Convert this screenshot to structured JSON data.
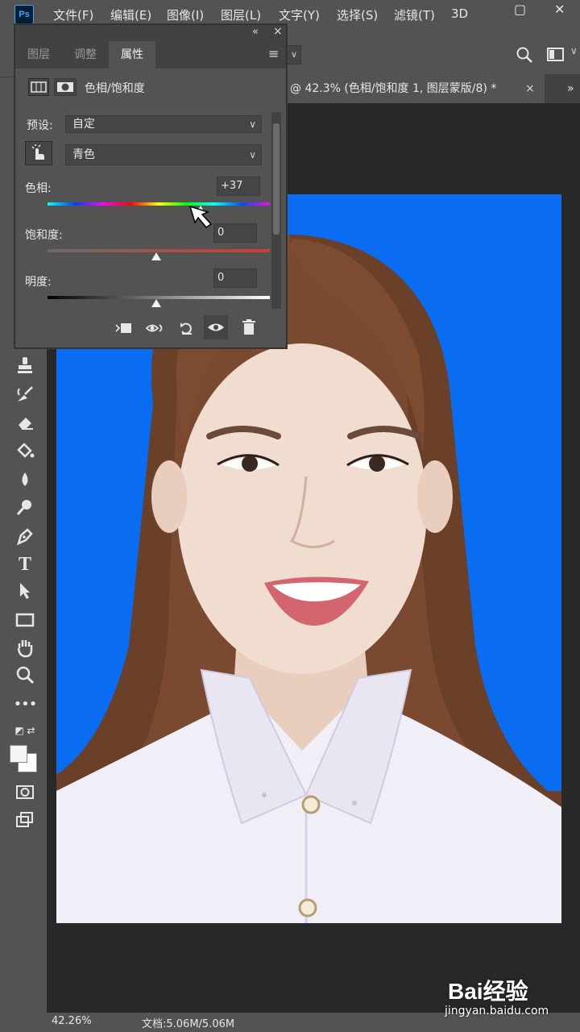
{
  "app": {
    "logo": "Ps"
  },
  "menu": [
    {
      "label": "文件(F)"
    },
    {
      "label": "编辑(E)"
    },
    {
      "label": "图像(I)"
    },
    {
      "label": "图层(L)"
    },
    {
      "label": "文字(Y)"
    },
    {
      "label": "选择(S)"
    },
    {
      "label": "滤镜(T)"
    },
    {
      "label": "3D"
    }
  ],
  "document_tab": {
    "title": "@ 42.3% (色相/饱和度 1, 图层蒙版/8) *",
    "close": "×",
    "more": "»"
  },
  "properties_panel": {
    "collapse": "«",
    "close": "×",
    "tabs": [
      {
        "label": "图层"
      },
      {
        "label": "调整"
      },
      {
        "label": "属性",
        "active": true
      }
    ],
    "menu_icon": "≡",
    "adjustment_title": "色相/饱和度",
    "preset": {
      "label": "预设:",
      "value": "自定"
    },
    "channel": {
      "value": "青色"
    },
    "hue": {
      "label": "色相:",
      "value": "+37",
      "position": 0.69
    },
    "saturation": {
      "label": "饱和度:",
      "value": "0",
      "position": 0.49
    },
    "lightness": {
      "label": "明度:",
      "value": "0",
      "position": 0.49
    },
    "footer_icons": [
      "clip-to-layer-icon",
      "view-previous-icon",
      "reset-icon",
      "visibility-eye-icon",
      "trash-icon"
    ]
  },
  "status": {
    "zoom": "42.26%",
    "doc": "文档:5.06M/5.06M"
  },
  "watermark": {
    "logo": "Bai经验",
    "url": "jingyan.baidu.com"
  },
  "colors": {
    "background_blue": "#0a6cf0",
    "panel": "#535353",
    "canvas_bg": "#282828"
  }
}
